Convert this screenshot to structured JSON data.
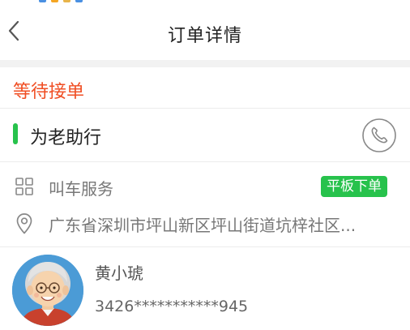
{
  "header": {
    "title": "订单详情",
    "back_icon": "chevron-left-icon"
  },
  "order": {
    "status": "等待接单",
    "status_color": "#f04e23"
  },
  "service": {
    "name": "为老助行",
    "accent_color": "#27c24c",
    "phone_icon": "phone-icon"
  },
  "ride": {
    "label": "叫车服务",
    "tag": "平板下单",
    "icon": "grid-icon"
  },
  "address": {
    "text": "广东省深圳市坪山新区坪山街道坑梓社区...",
    "icon": "location-pin-icon"
  },
  "passenger": {
    "name": "黄小琥",
    "phone": "3426***********945",
    "avatar_icon": "elderly-avatar"
  }
}
